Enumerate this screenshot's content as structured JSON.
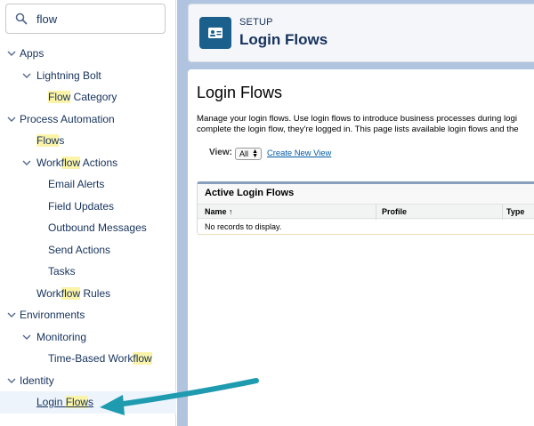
{
  "sidebar": {
    "search_value": "flow",
    "items": [
      {
        "pre": "",
        "hl": "",
        "post": "Apps"
      },
      {
        "pre": "",
        "hl": "",
        "post": "Lightning Bolt"
      },
      {
        "pre": "",
        "hl": "Flow",
        "post": " Category"
      },
      {
        "pre": "",
        "hl": "",
        "post": "Process Automation"
      },
      {
        "pre": "",
        "hl": "Flow",
        "post": "s"
      },
      {
        "pre": "Work",
        "hl": "flow",
        "post": " Actions"
      },
      {
        "pre": "",
        "hl": "",
        "post": "Email Alerts"
      },
      {
        "pre": "",
        "hl": "",
        "post": "Field Updates"
      },
      {
        "pre": "",
        "hl": "",
        "post": "Outbound Messages"
      },
      {
        "pre": "",
        "hl": "",
        "post": "Send Actions"
      },
      {
        "pre": "",
        "hl": "",
        "post": "Tasks"
      },
      {
        "pre": "Work",
        "hl": "flow",
        "post": " Rules"
      },
      {
        "pre": "",
        "hl": "",
        "post": "Environments"
      },
      {
        "pre": "",
        "hl": "",
        "post": "Monitoring"
      },
      {
        "pre": "Time-Based Work",
        "hl": "flow",
        "post": ""
      },
      {
        "pre": "",
        "hl": "",
        "post": "Identity"
      },
      {
        "pre": "Login ",
        "hl": "Flow",
        "post": "s"
      }
    ]
  },
  "header": {
    "setup_label": "SETUP",
    "title": "Login Flows"
  },
  "main": {
    "page_title": "Login Flows",
    "desc_line1": "Manage your login flows. Use login flows to introduce business processes during logi",
    "desc_line2": "complete the login flow, they're logged in. This page lists available login flows and the",
    "view_label": "View:",
    "view_value": "All",
    "create_view_link": "Create New View",
    "panel": {
      "title": "Active Login Flows",
      "columns": [
        "Name",
        "Profile",
        "Type"
      ],
      "sort_glyph": "↑",
      "empty_message": "No records to display."
    }
  },
  "colors": {
    "accent": "#1b5f8c",
    "highlight": "#fbf3a8",
    "annotation_arrow": "#1f9bb0",
    "background": "#b0c4df"
  }
}
